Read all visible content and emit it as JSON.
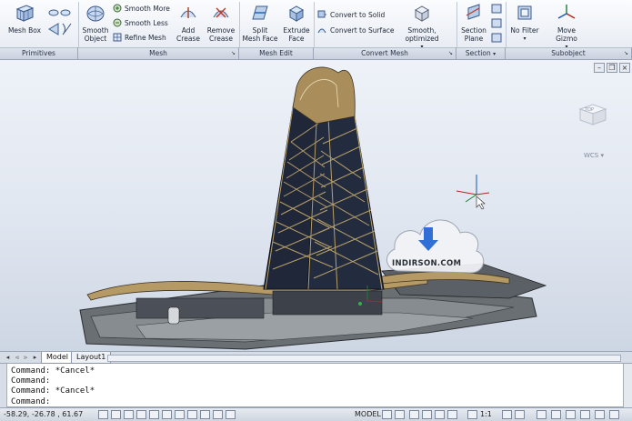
{
  "ribbon": {
    "primitives": {
      "mesh_box": "Mesh Box"
    },
    "mesh": {
      "smooth_object": [
        "Smooth",
        "Object"
      ],
      "smooth_more": "Smooth More",
      "smooth_less": "Smooth Less",
      "refine_mesh": "Refine Mesh",
      "add_crease": [
        "Add",
        "Crease"
      ],
      "remove_crease": [
        "Remove",
        "Crease"
      ]
    },
    "mesh_edit": {
      "split_mesh_face": [
        "Split",
        "Mesh Face"
      ],
      "extrude_face": [
        "Extrude",
        "Face"
      ]
    },
    "convert_mesh": {
      "convert_to_solid": "Convert to Solid",
      "convert_to_surface": "Convert to Surface",
      "smooth_optimized": "Smooth, optimized"
    },
    "section": {
      "section_plane": [
        "Section",
        "Plane"
      ]
    },
    "subobject": {
      "no_filter": "No Filter",
      "move_gizmo": "Move Gizmo"
    },
    "panels": [
      "Primitives",
      "Mesh",
      "Mesh Edit",
      "Convert Mesh",
      "Section",
      "Subobject"
    ]
  },
  "viewport": {
    "viewcube_top": "TOP",
    "wcs_label": "WCS",
    "watermark": "INDIRSON.COM"
  },
  "tabs": [
    "Model",
    "Layout1"
  ],
  "command_lines": [
    "Command: *Cancel*",
    "Command:",
    "Command: *Cancel*",
    "Command:"
  ],
  "status": {
    "coords": "-58.29, -26.78 , 61.67",
    "model": "MODEL",
    "scale": "1:1"
  },
  "colors": {
    "ribbon_bg": "#eef1f6",
    "viewport_bg": "#e3e8f1",
    "tower_dark": "#1e2638",
    "tower_gold": "#b8a06a",
    "accent_blue": "#2f6fd6"
  }
}
